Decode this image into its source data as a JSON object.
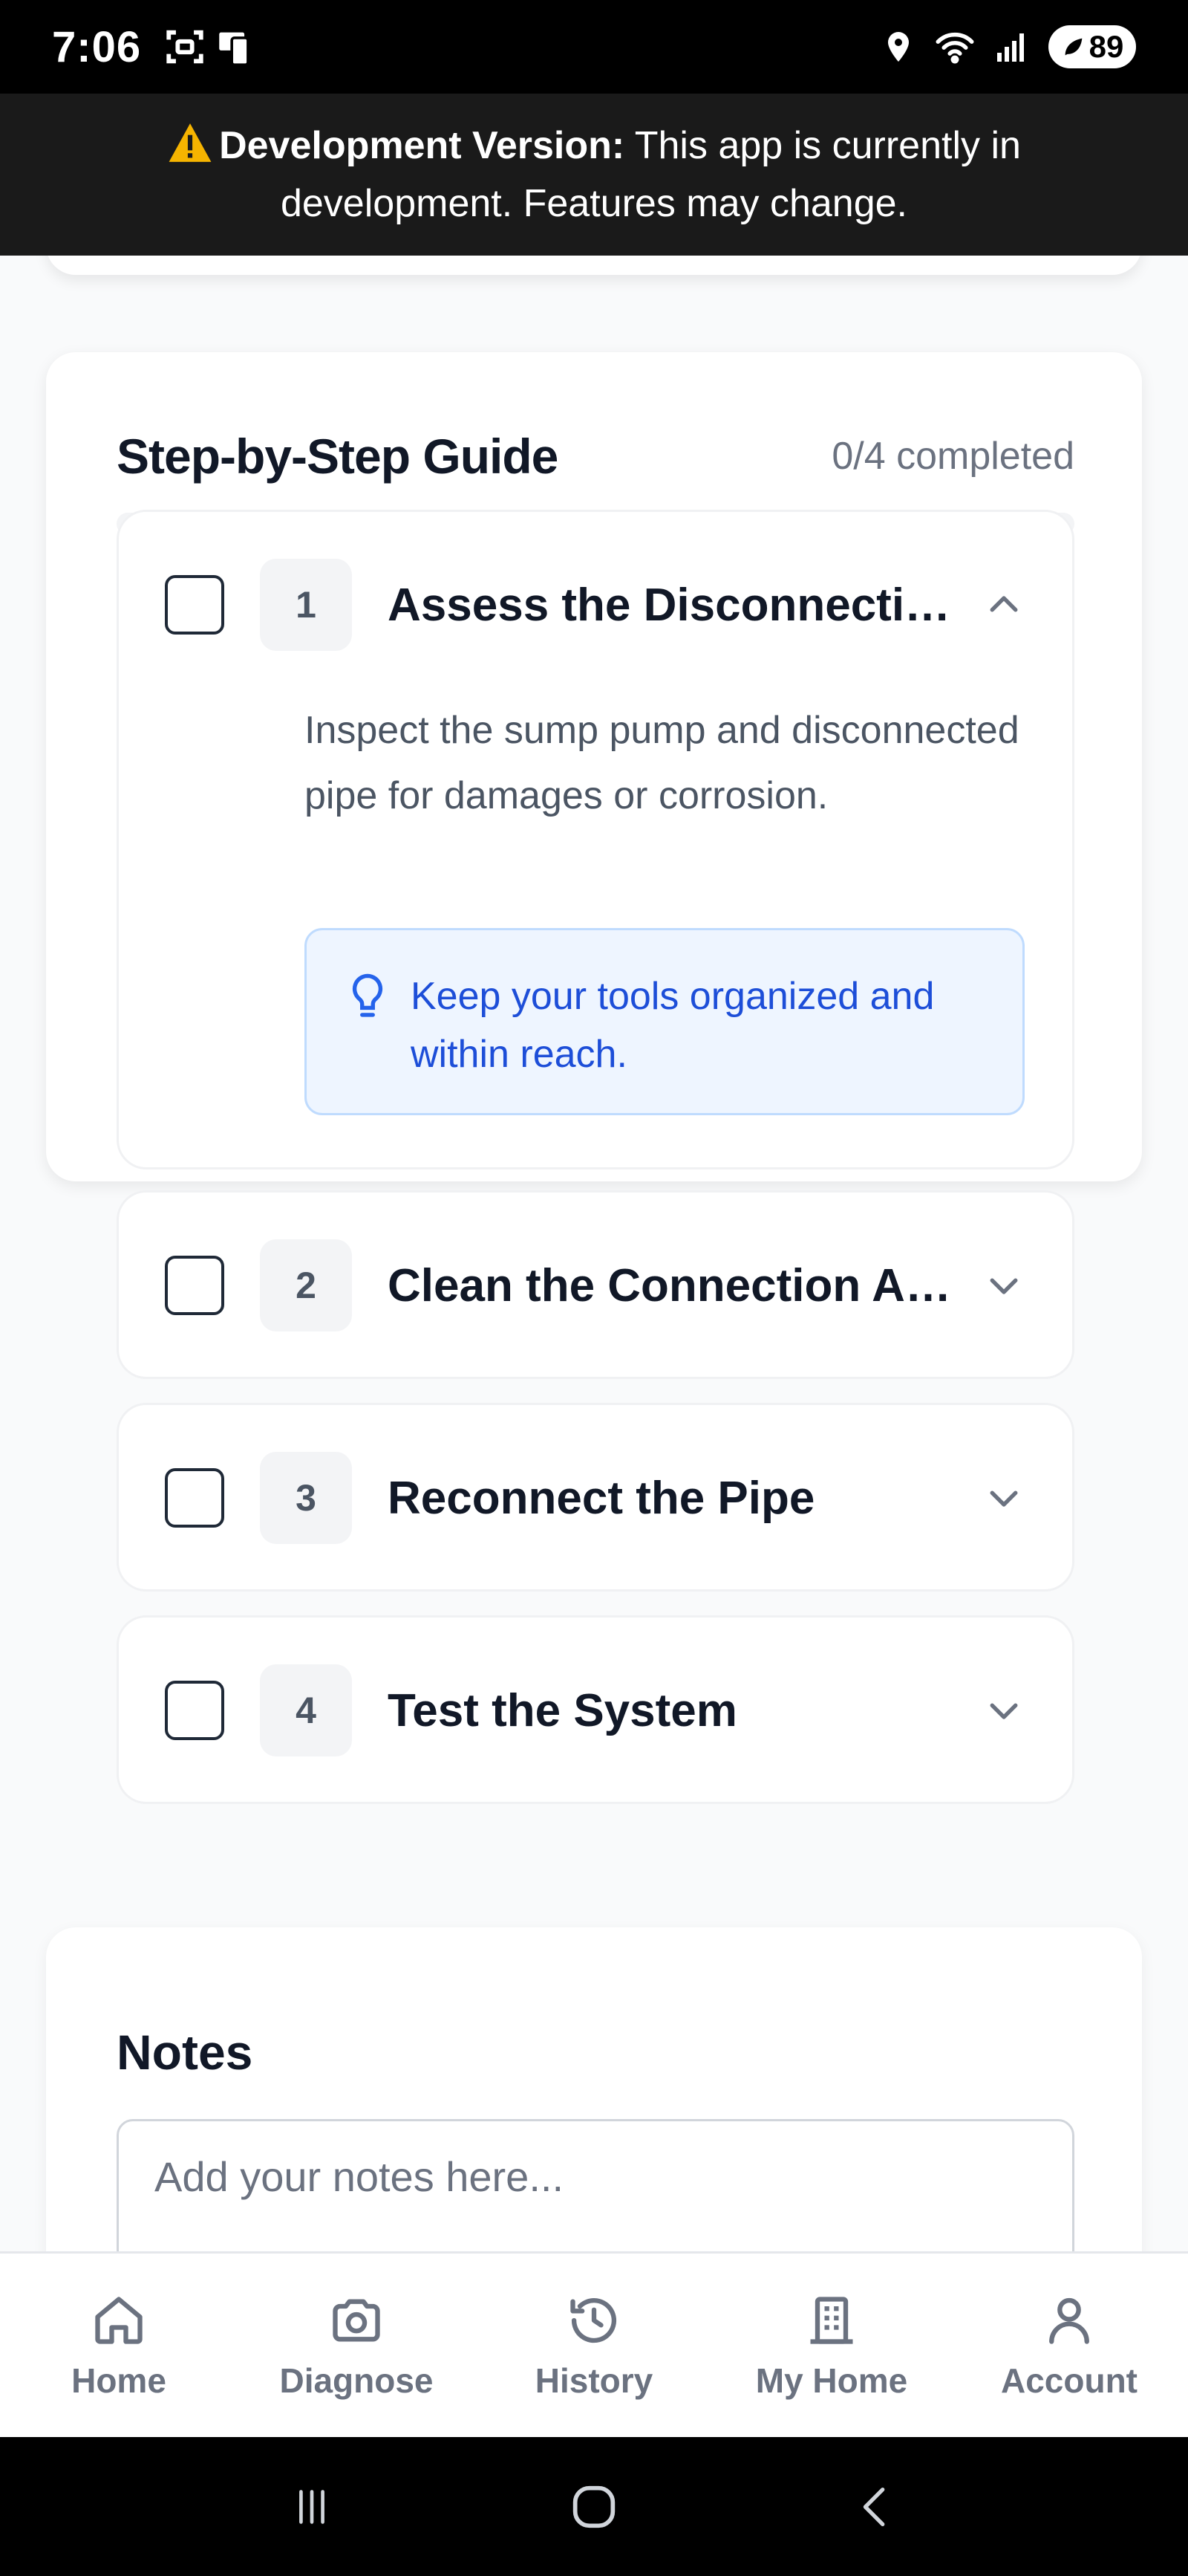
{
  "status_bar": {
    "time": "7:06",
    "battery": "89"
  },
  "dev_banner": {
    "label": "Development Version:",
    "message": " This app is currently in development. Features may change."
  },
  "guide": {
    "title": "Step-by-Step Guide",
    "progress_text": "0/4 completed",
    "progress_fraction": 0,
    "steps": [
      {
        "number": "1",
        "title": "Assess the Disconnection",
        "expanded": true,
        "checked": false,
        "description": "Inspect the sump pump and disconnected pipe for damages or corrosion.",
        "tip": "Keep your tools organized and within reach."
      },
      {
        "number": "2",
        "title": "Clean the Connection Area",
        "expanded": false,
        "checked": false
      },
      {
        "number": "3",
        "title": "Reconnect the Pipe",
        "expanded": false,
        "checked": false
      },
      {
        "number": "4",
        "title": "Test the System",
        "expanded": false,
        "checked": false
      }
    ]
  },
  "notes": {
    "title": "Notes",
    "placeholder": "Add your notes here..."
  },
  "bottom_nav": {
    "items": [
      {
        "label": "Home",
        "icon": "home-icon"
      },
      {
        "label": "Diagnose",
        "icon": "camera-icon"
      },
      {
        "label": "History",
        "icon": "history-icon"
      },
      {
        "label": "My Home",
        "icon": "building-icon"
      },
      {
        "label": "Account",
        "icon": "user-icon"
      }
    ]
  },
  "colors": {
    "accent": "#2563eb",
    "tip_text": "#1d4ed8",
    "tip_bg": "#eef5ff",
    "banner_bg": "#1a1a1a"
  }
}
